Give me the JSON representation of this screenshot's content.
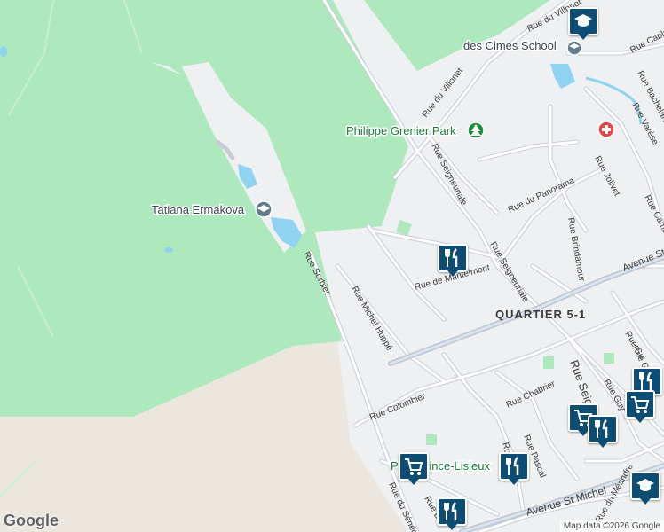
{
  "map": {
    "colors": {
      "forest": "#aee8bd",
      "land": "#eef0f2",
      "sand": "#ece7de",
      "road": "#ffffff",
      "road_edge": "#c8ccd2",
      "water": "#8fd3f0",
      "arterial": "#b9c6d4",
      "marker": "#0e4d73"
    },
    "pois": {
      "school_label": "des Cimes School",
      "park_label": "Philippe Grenier Park",
      "place_label": "Tatiana Ermakova",
      "parc_label": "Parc Prince-Lisieux",
      "district_label": "QUARTIER 5-1"
    },
    "streets": {
      "villonet_top": "Rue du Villonet",
      "villonet": "Rue du Villonet",
      "caplan": "Rue Caplan",
      "bachelard": "Rue Bachelard",
      "varese": "Rue Varèse",
      "jolivet": "Rue Jolivet",
      "cambert": "Rue Cambert",
      "panorama": "Rue du Panorama",
      "brindamour": "Rue Brindamour",
      "seigneuriale_1": "Rue Seigneuriale",
      "seigneuriale_2": "Rue Seigneuriale",
      "seigneuriale_3": "Rue Seigneuriale",
      "avenue_s": "Avenue St",
      "mantelmont": "Rue de Mantelmont",
      "michel_huppe": "Rue Michel Huppé",
      "sorbier": "Rue Sorbier",
      "colombier": "Rue Colombier",
      "chabrier": "Rue Chabrier",
      "pascal": "Rue Pascal",
      "glinel": "Rue Glinel",
      "gu": "Rue Gu",
      "givot": "Rue Givot",
      "guy": "Rue Guy",
      "avenue_st_michel": "Avenue St Michel",
      "senechal": "Rue du Sénéchal",
      "rue_d": "Rue D",
      "meandre": "Rue du Méandre"
    },
    "markers": [
      "school-icon",
      "restaurant-icon",
      "grocery-icon",
      "hospital-icon",
      "park-icon"
    ],
    "logo": "Google",
    "attribution": "Map data ©2026 Google"
  }
}
